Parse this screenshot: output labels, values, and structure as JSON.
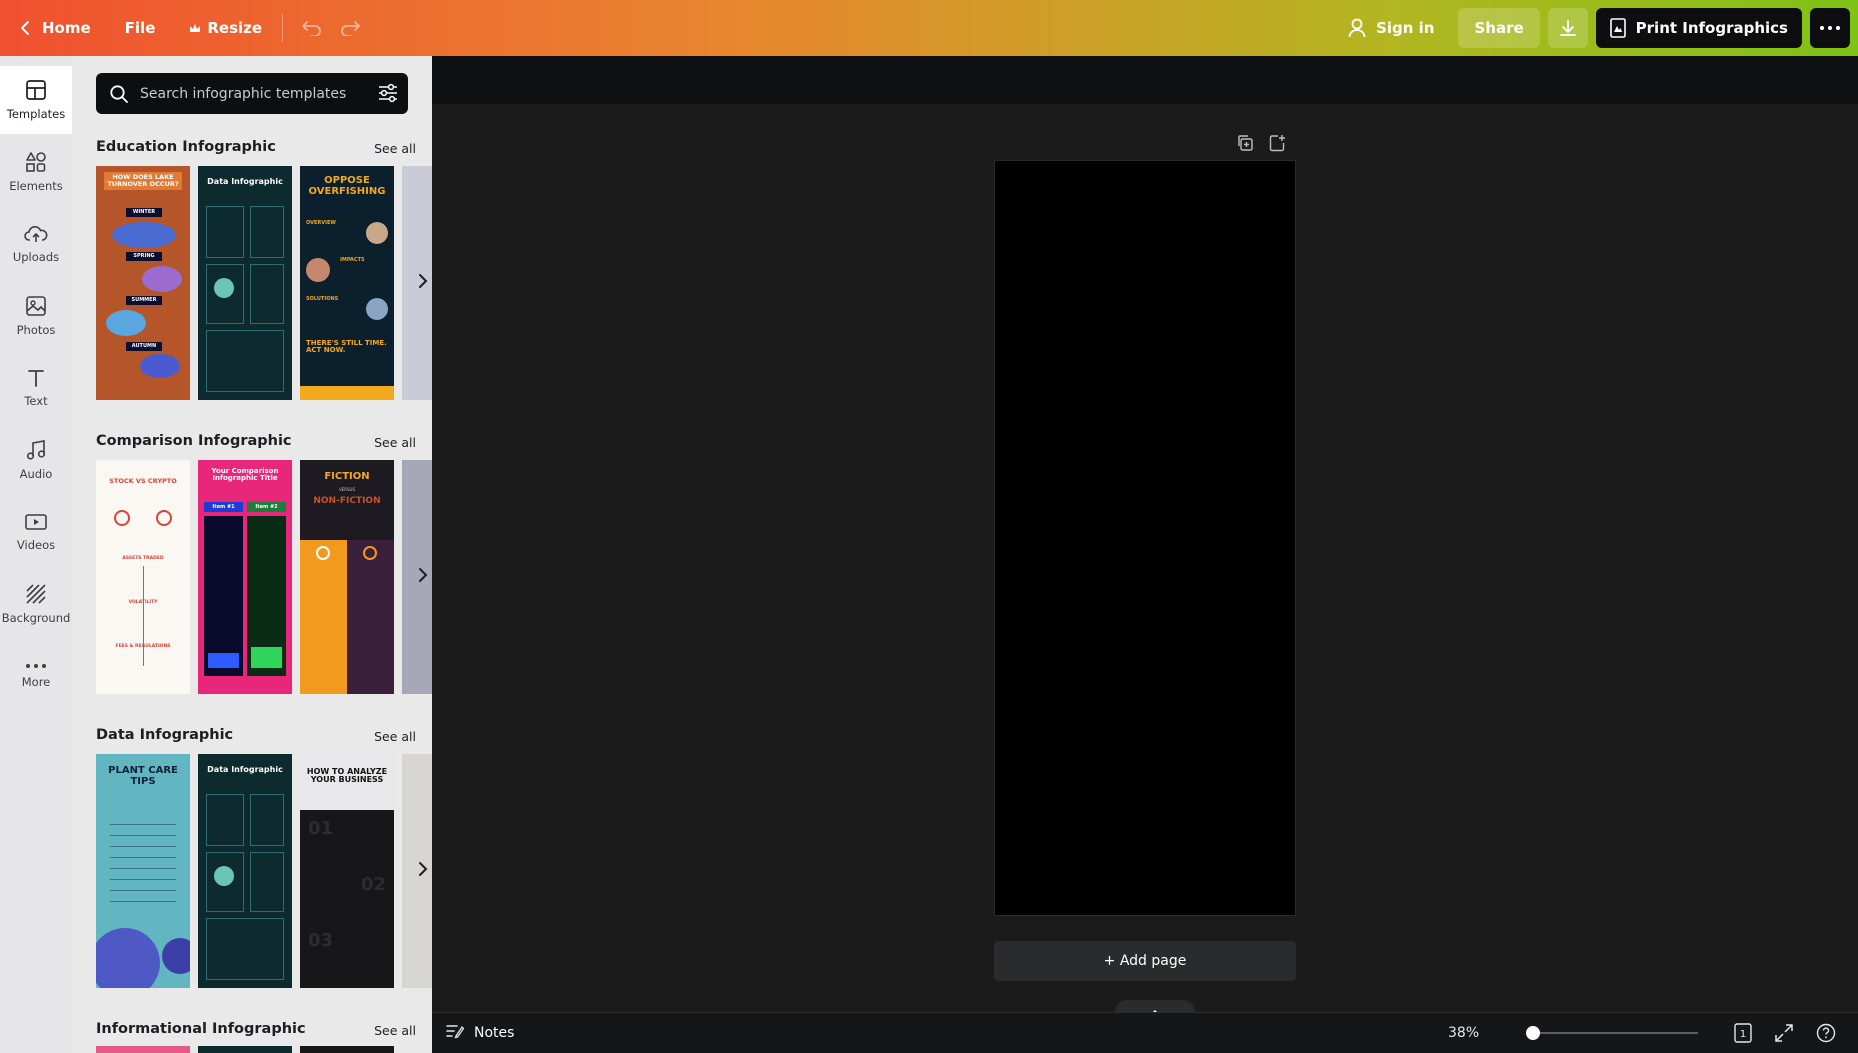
{
  "topbar": {
    "home_label": "Home",
    "file_label": "File",
    "resize_label": "Resize",
    "signin_label": "Sign in",
    "share_label": "Share",
    "print_label": "Print Infographics"
  },
  "rail": {
    "items": [
      {
        "label": "Templates",
        "icon": "templates-icon"
      },
      {
        "label": "Elements",
        "icon": "elements-icon"
      },
      {
        "label": "Uploads",
        "icon": "upload-cloud-icon"
      },
      {
        "label": "Photos",
        "icon": "photos-icon"
      },
      {
        "label": "Text",
        "icon": "text-icon"
      },
      {
        "label": "Audio",
        "icon": "music-note-icon"
      },
      {
        "label": "Videos",
        "icon": "video-icon"
      },
      {
        "label": "Background",
        "icon": "background-icon"
      },
      {
        "label": "More",
        "icon": "more-dots-icon"
      }
    ]
  },
  "search": {
    "placeholder": "Search infographic templates"
  },
  "sections": [
    {
      "title": "Education Infographic",
      "see_all": "See all",
      "thumbs": [
        {
          "title": "HOW DOES LAKE TURNOVER OCCUR?",
          "labels": [
            "WINTER",
            "SPRING",
            "SUMMER",
            "AUTUMN"
          ],
          "bg": "#b4552a"
        },
        {
          "title": "Data Infographic",
          "bg": "#0d2a2e"
        },
        {
          "title": "OPPOSE OVERFISHING",
          "labels": [
            "OVERVIEW",
            "IMPACTS",
            "SOLUTIONS",
            "THERE'S STILL TIME. ACT NOW."
          ],
          "bg": "#0c1f2c"
        }
      ]
    },
    {
      "title": "Comparison Infographic",
      "see_all": "See all",
      "thumbs": [
        {
          "title": "STOCK VS CRYPTO",
          "labels": [
            "ASSETS TRADED",
            "VOLATILITY",
            "FEES & REGULATIONS"
          ],
          "bg": "#fbf7f2"
        },
        {
          "title": "Your Comparison Infographic Title",
          "labels": [
            "Item #1",
            "Item #2"
          ],
          "bg": "#e8267a"
        },
        {
          "title": "FICTION",
          "labels": [
            "VERSUS",
            "NON-FICTION"
          ],
          "bg": "#1d1a22"
        }
      ]
    },
    {
      "title": "Data Infographic",
      "see_all": "See all",
      "thumbs": [
        {
          "title": "PLANT CARE TIPS",
          "bg": "#62b6c1"
        },
        {
          "title": "Data Infographic",
          "bg": "#0d2a2e"
        },
        {
          "title": "HOW TO ANALYZE YOUR BUSINESS",
          "labels": [
            "01",
            "02",
            "03"
          ],
          "bg": "#17171a"
        }
      ]
    },
    {
      "title": "Informational Infographic",
      "see_all": "See all",
      "thumbs": []
    }
  ],
  "canvas": {
    "add_page_label": "+ Add page"
  },
  "footer": {
    "notes_label": "Notes",
    "zoom_label": "38%",
    "zoom_percent": 38,
    "page_count": "1"
  },
  "colors": {
    "topbar_gradient_start": "#f0512f",
    "topbar_gradient_end": "#7fc215",
    "panel_bg": "#e9e9ea",
    "canvas_bg": "#1b1b1c"
  }
}
